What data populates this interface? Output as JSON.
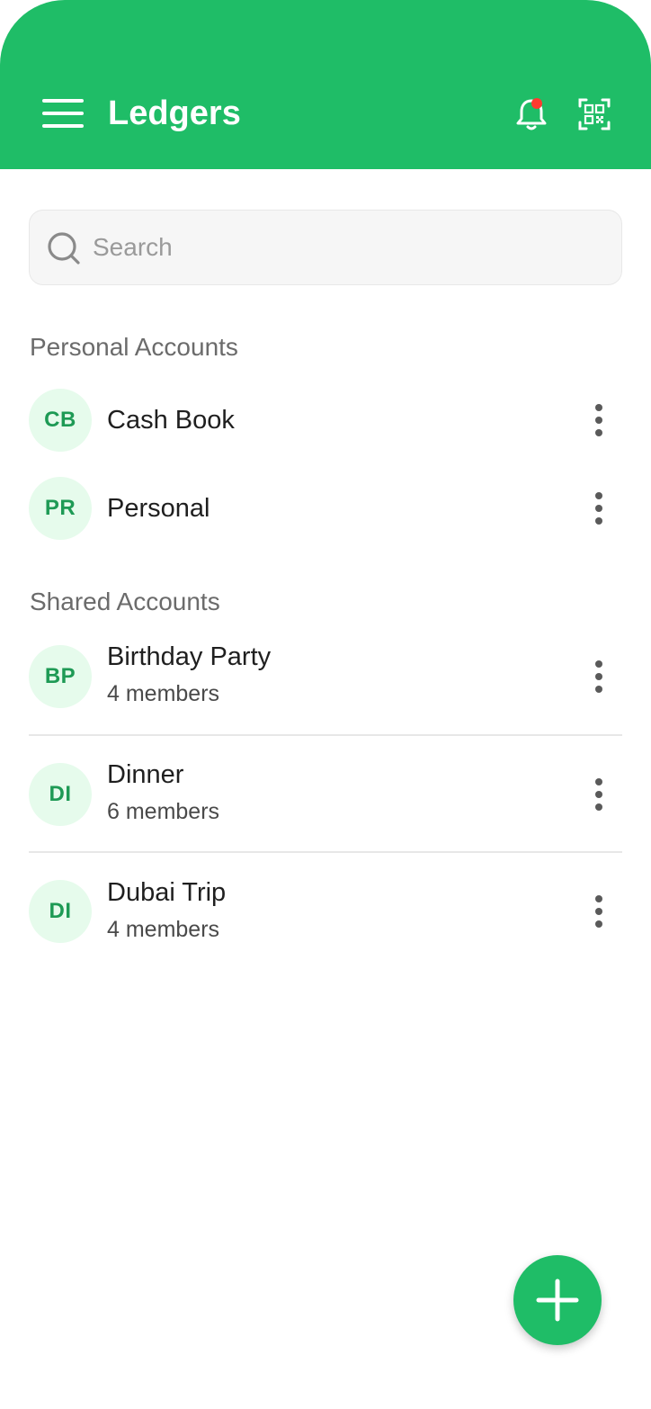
{
  "header": {
    "title": "Ledgers",
    "menu_icon": "hamburger-menu-icon",
    "notification_icon": "bell-icon",
    "scan_icon": "qr-scan-icon",
    "background_color": "#1fbd67",
    "notification_dot_color": "#ff3b30"
  },
  "search": {
    "placeholder": "Search",
    "value": ""
  },
  "personal": {
    "title": "Personal Accounts",
    "items": [
      {
        "initials": "CB",
        "name": "Cash Book"
      },
      {
        "initials": "PR",
        "name": "Personal"
      }
    ]
  },
  "shared": {
    "title": "Shared Accounts",
    "items": [
      {
        "initials": "BP",
        "name": "Birthday Party",
        "members": "4 members"
      },
      {
        "initials": "DI",
        "name": "Dinner",
        "members": "6 members"
      },
      {
        "initials": "DI",
        "name": "Dubai Trip",
        "members": "4 members"
      }
    ]
  },
  "fab": {
    "icon": "plus-icon"
  },
  "colors": {
    "accent": "#1fbd67",
    "avatar_bg": "#e6fbec",
    "avatar_text": "#1e9a55"
  }
}
